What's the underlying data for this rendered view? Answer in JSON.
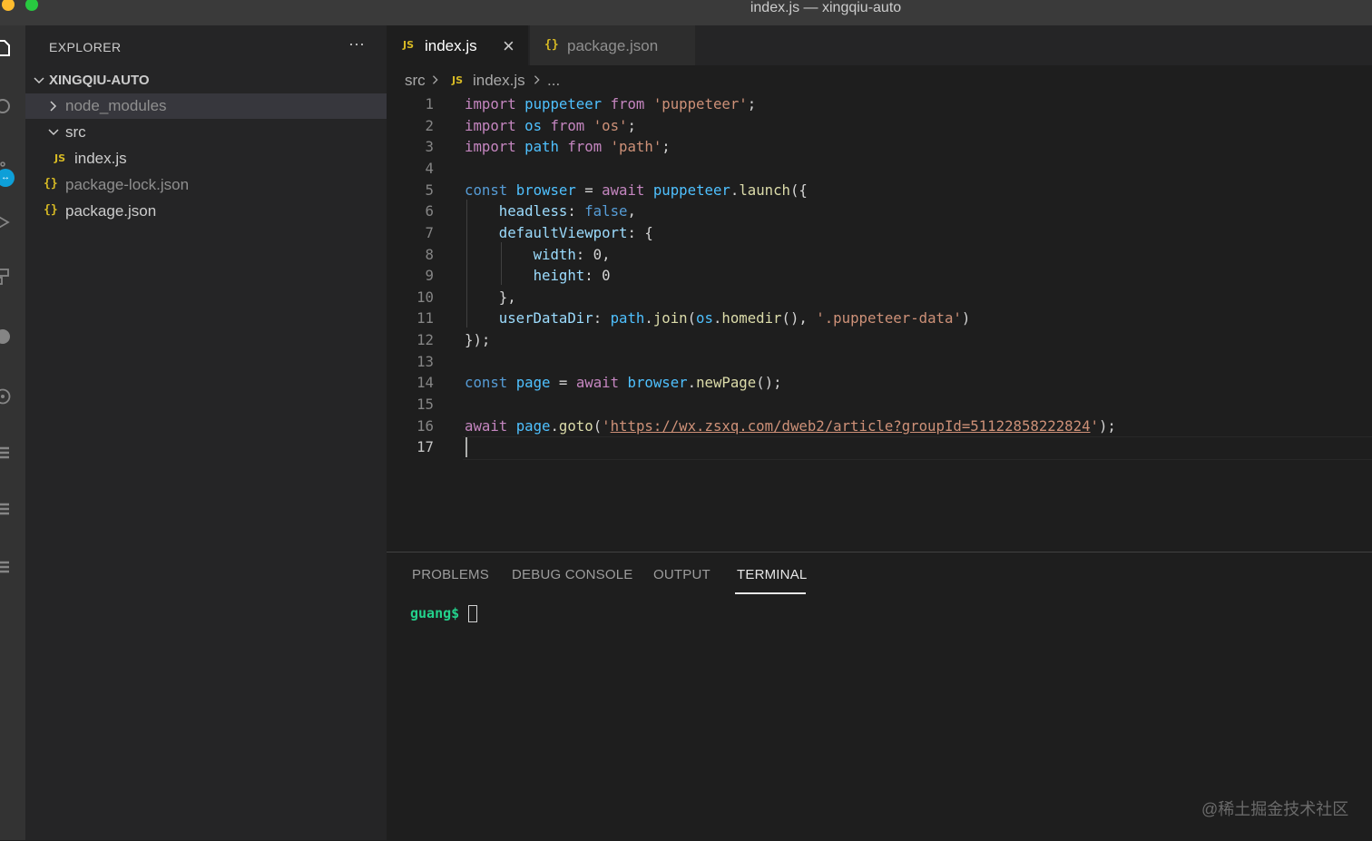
{
  "window": {
    "title": "index.js — xingqiu-auto"
  },
  "sidebar": {
    "title": "EXPLORER",
    "more": "···",
    "folder": "XINGQIU-AUTO",
    "items": [
      {
        "label": "node_modules",
        "type": "folder",
        "expanded": false
      },
      {
        "label": "src",
        "type": "folder",
        "expanded": true
      },
      {
        "label": "index.js",
        "type": "js-file",
        "icon": "JS"
      },
      {
        "label": "package-lock.json",
        "type": "json-file",
        "icon": "{}"
      },
      {
        "label": "package.json",
        "type": "json-file",
        "icon": "{}"
      }
    ]
  },
  "tabs": [
    {
      "label": "index.js",
      "icon": "JS",
      "active": true,
      "close": "×"
    },
    {
      "label": "package.json",
      "icon": "{}",
      "active": false
    }
  ],
  "breadcrumb": {
    "folder": "src",
    "file_icon": "JS",
    "file": "index.js",
    "ellipsis": "..."
  },
  "editor": {
    "line_numbers": [
      "1",
      "2",
      "3",
      "4",
      "5",
      "6",
      "7",
      "8",
      "9",
      "10",
      "11",
      "12",
      "13",
      "14",
      "15",
      "16",
      "17"
    ],
    "active_line": "17",
    "code_lines": [
      "import puppeteer from 'puppeteer';",
      "import os from 'os';",
      "import path from 'path';",
      "",
      "const browser = await puppeteer.launch({",
      "    headless: false,",
      "    defaultViewport: {",
      "        width: 0,",
      "        height: 0",
      "    },",
      "    userDataDir: path.join(os.homedir(), '.puppeteer-data')",
      "});",
      "",
      "const page = await browser.newPage();",
      "",
      "await page.goto('https://wx.zsxq.com/dweb2/article?groupId=51122858222824');",
      ""
    ]
  },
  "panel": {
    "tabs": [
      "PROBLEMS",
      "DEBUG CONSOLE",
      "OUTPUT",
      "TERMINAL"
    ],
    "active_tab": "TERMINAL",
    "prompt": "guang$"
  },
  "watermark": "@稀土掘金技术社区",
  "colors": {
    "accent": "#d7ba24",
    "terminal_prompt": "#23d18b",
    "editor_bg": "#1e1e1e",
    "sidebar_bg": "#252526"
  }
}
